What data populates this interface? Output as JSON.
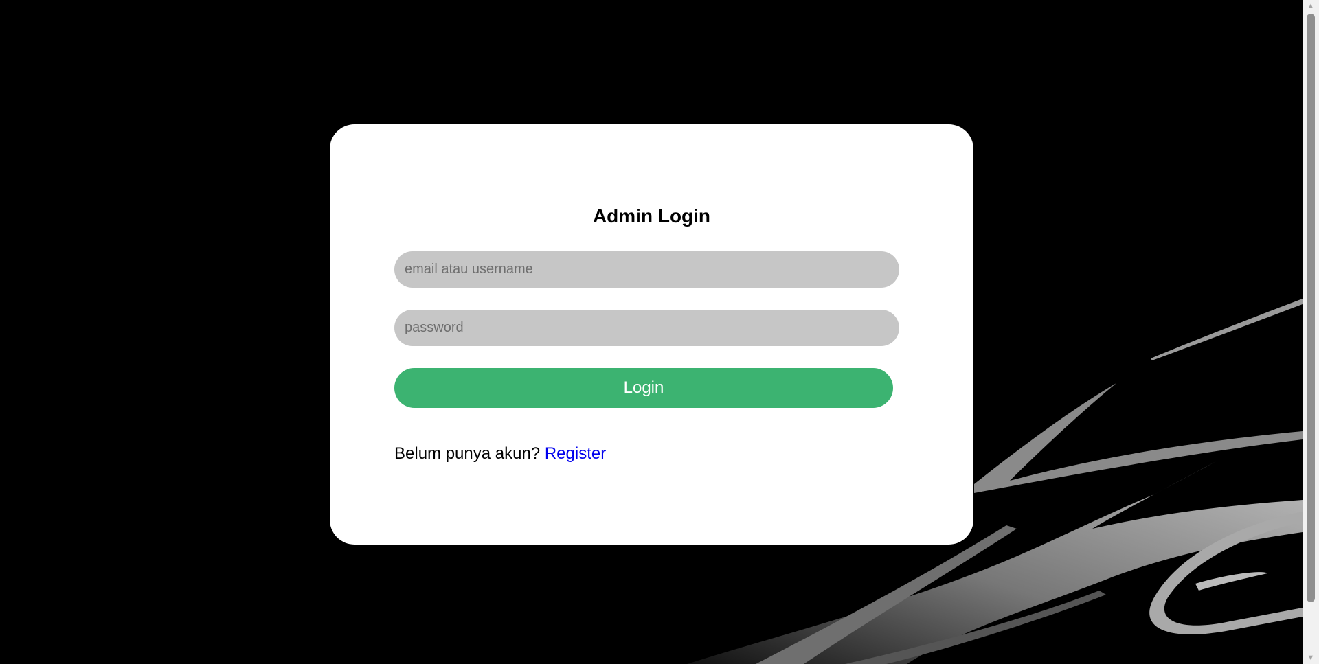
{
  "login": {
    "title": "Admin Login",
    "email_placeholder": "email atau username",
    "password_placeholder": "password",
    "submit_label": "Login",
    "register_prompt": "Belum punya akun?",
    "register_link": "Register"
  },
  "colors": {
    "background": "#000000",
    "card": "#ffffff",
    "input": "#c6c6c6",
    "button": "#3cb371",
    "link": "#0000ee"
  },
  "icons": {
    "scroll_up": "scroll-up-arrow-icon",
    "scroll_down": "scroll-down-arrow-icon"
  }
}
